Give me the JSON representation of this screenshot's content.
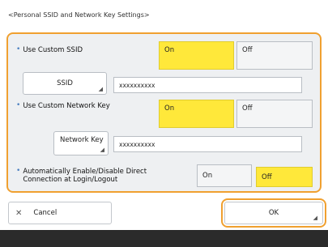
{
  "title": "<Personal SSID and Network Key Settings>",
  "custom_ssid": {
    "label": "Use Custom SSID",
    "on_label": "On",
    "off_label": "Off",
    "selected": "On",
    "ssid_button": "SSID",
    "ssid_value": "xxxxxxxxxx"
  },
  "custom_key": {
    "label": "Use Custom Network Key",
    "on_label": "On",
    "off_label": "Off",
    "selected": "On",
    "key_button": "Network Key",
    "key_value": "xxxxxxxxxx"
  },
  "auto_direct": {
    "label_line1": "Automatically Enable/Disable Direct",
    "label_line2": "Connection at Login/Logout",
    "on_label": "On",
    "off_label": "Off",
    "selected": "Off"
  },
  "footer_buttons": {
    "cancel": "Cancel",
    "ok": "OK"
  },
  "colors": {
    "accent": "#f0a030",
    "selected": "#ffe83a",
    "panel_bg": "#eef0f2",
    "bullet": "#4a7fc0",
    "footer": "#2b2b2b"
  }
}
